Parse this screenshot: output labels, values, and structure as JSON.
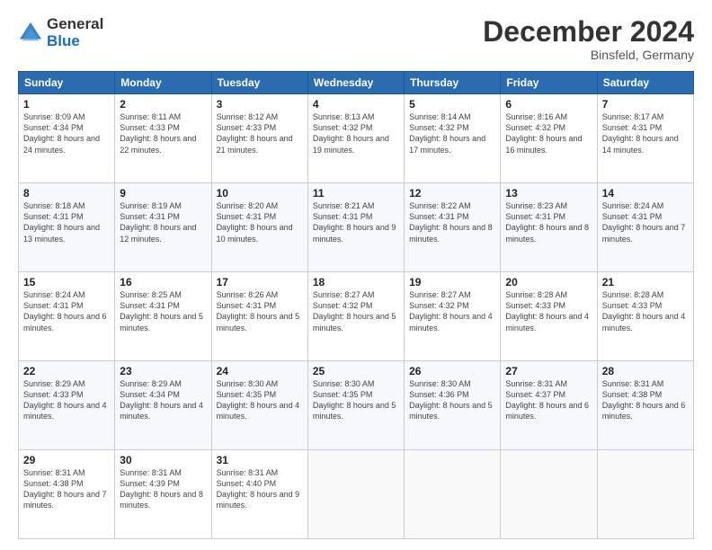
{
  "logo": {
    "general": "General",
    "blue": "Blue"
  },
  "title": "December 2024",
  "location": "Binsfeld, Germany",
  "days_of_week": [
    "Sunday",
    "Monday",
    "Tuesday",
    "Wednesday",
    "Thursday",
    "Friday",
    "Saturday"
  ],
  "weeks": [
    [
      {
        "day": "1",
        "sunrise": "Sunrise: 8:09 AM",
        "sunset": "Sunset: 4:34 PM",
        "daylight": "Daylight: 8 hours and 24 minutes."
      },
      {
        "day": "2",
        "sunrise": "Sunrise: 8:11 AM",
        "sunset": "Sunset: 4:33 PM",
        "daylight": "Daylight: 8 hours and 22 minutes."
      },
      {
        "day": "3",
        "sunrise": "Sunrise: 8:12 AM",
        "sunset": "Sunset: 4:33 PM",
        "daylight": "Daylight: 8 hours and 21 minutes."
      },
      {
        "day": "4",
        "sunrise": "Sunrise: 8:13 AM",
        "sunset": "Sunset: 4:32 PM",
        "daylight": "Daylight: 8 hours and 19 minutes."
      },
      {
        "day": "5",
        "sunrise": "Sunrise: 8:14 AM",
        "sunset": "Sunset: 4:32 PM",
        "daylight": "Daylight: 8 hours and 17 minutes."
      },
      {
        "day": "6",
        "sunrise": "Sunrise: 8:16 AM",
        "sunset": "Sunset: 4:32 PM",
        "daylight": "Daylight: 8 hours and 16 minutes."
      },
      {
        "day": "7",
        "sunrise": "Sunrise: 8:17 AM",
        "sunset": "Sunset: 4:31 PM",
        "daylight": "Daylight: 8 hours and 14 minutes."
      }
    ],
    [
      {
        "day": "8",
        "sunrise": "Sunrise: 8:18 AM",
        "sunset": "Sunset: 4:31 PM",
        "daylight": "Daylight: 8 hours and 13 minutes."
      },
      {
        "day": "9",
        "sunrise": "Sunrise: 8:19 AM",
        "sunset": "Sunset: 4:31 PM",
        "daylight": "Daylight: 8 hours and 12 minutes."
      },
      {
        "day": "10",
        "sunrise": "Sunrise: 8:20 AM",
        "sunset": "Sunset: 4:31 PM",
        "daylight": "Daylight: 8 hours and 10 minutes."
      },
      {
        "day": "11",
        "sunrise": "Sunrise: 8:21 AM",
        "sunset": "Sunset: 4:31 PM",
        "daylight": "Daylight: 8 hours and 9 minutes."
      },
      {
        "day": "12",
        "sunrise": "Sunrise: 8:22 AM",
        "sunset": "Sunset: 4:31 PM",
        "daylight": "Daylight: 8 hours and 8 minutes."
      },
      {
        "day": "13",
        "sunrise": "Sunrise: 8:23 AM",
        "sunset": "Sunset: 4:31 PM",
        "daylight": "Daylight: 8 hours and 8 minutes."
      },
      {
        "day": "14",
        "sunrise": "Sunrise: 8:24 AM",
        "sunset": "Sunset: 4:31 PM",
        "daylight": "Daylight: 8 hours and 7 minutes."
      }
    ],
    [
      {
        "day": "15",
        "sunrise": "Sunrise: 8:24 AM",
        "sunset": "Sunset: 4:31 PM",
        "daylight": "Daylight: 8 hours and 6 minutes."
      },
      {
        "day": "16",
        "sunrise": "Sunrise: 8:25 AM",
        "sunset": "Sunset: 4:31 PM",
        "daylight": "Daylight: 8 hours and 5 minutes."
      },
      {
        "day": "17",
        "sunrise": "Sunrise: 8:26 AM",
        "sunset": "Sunset: 4:31 PM",
        "daylight": "Daylight: 8 hours and 5 minutes."
      },
      {
        "day": "18",
        "sunrise": "Sunrise: 8:27 AM",
        "sunset": "Sunset: 4:32 PM",
        "daylight": "Daylight: 8 hours and 5 minutes."
      },
      {
        "day": "19",
        "sunrise": "Sunrise: 8:27 AM",
        "sunset": "Sunset: 4:32 PM",
        "daylight": "Daylight: 8 hours and 4 minutes."
      },
      {
        "day": "20",
        "sunrise": "Sunrise: 8:28 AM",
        "sunset": "Sunset: 4:33 PM",
        "daylight": "Daylight: 8 hours and 4 minutes."
      },
      {
        "day": "21",
        "sunrise": "Sunrise: 8:28 AM",
        "sunset": "Sunset: 4:33 PM",
        "daylight": "Daylight: 8 hours and 4 minutes."
      }
    ],
    [
      {
        "day": "22",
        "sunrise": "Sunrise: 8:29 AM",
        "sunset": "Sunset: 4:33 PM",
        "daylight": "Daylight: 8 hours and 4 minutes."
      },
      {
        "day": "23",
        "sunrise": "Sunrise: 8:29 AM",
        "sunset": "Sunset: 4:34 PM",
        "daylight": "Daylight: 8 hours and 4 minutes."
      },
      {
        "day": "24",
        "sunrise": "Sunrise: 8:30 AM",
        "sunset": "Sunset: 4:35 PM",
        "daylight": "Daylight: 8 hours and 4 minutes."
      },
      {
        "day": "25",
        "sunrise": "Sunrise: 8:30 AM",
        "sunset": "Sunset: 4:35 PM",
        "daylight": "Daylight: 8 hours and 5 minutes."
      },
      {
        "day": "26",
        "sunrise": "Sunrise: 8:30 AM",
        "sunset": "Sunset: 4:36 PM",
        "daylight": "Daylight: 8 hours and 5 minutes."
      },
      {
        "day": "27",
        "sunrise": "Sunrise: 8:31 AM",
        "sunset": "Sunset: 4:37 PM",
        "daylight": "Daylight: 8 hours and 6 minutes."
      },
      {
        "day": "28",
        "sunrise": "Sunrise: 8:31 AM",
        "sunset": "Sunset: 4:38 PM",
        "daylight": "Daylight: 8 hours and 6 minutes."
      }
    ],
    [
      {
        "day": "29",
        "sunrise": "Sunrise: 8:31 AM",
        "sunset": "Sunset: 4:38 PM",
        "daylight": "Daylight: 8 hours and 7 minutes."
      },
      {
        "day": "30",
        "sunrise": "Sunrise: 8:31 AM",
        "sunset": "Sunset: 4:39 PM",
        "daylight": "Daylight: 8 hours and 8 minutes."
      },
      {
        "day": "31",
        "sunrise": "Sunrise: 8:31 AM",
        "sunset": "Sunset: 4:40 PM",
        "daylight": "Daylight: 8 hours and 9 minutes."
      },
      null,
      null,
      null,
      null
    ]
  ]
}
